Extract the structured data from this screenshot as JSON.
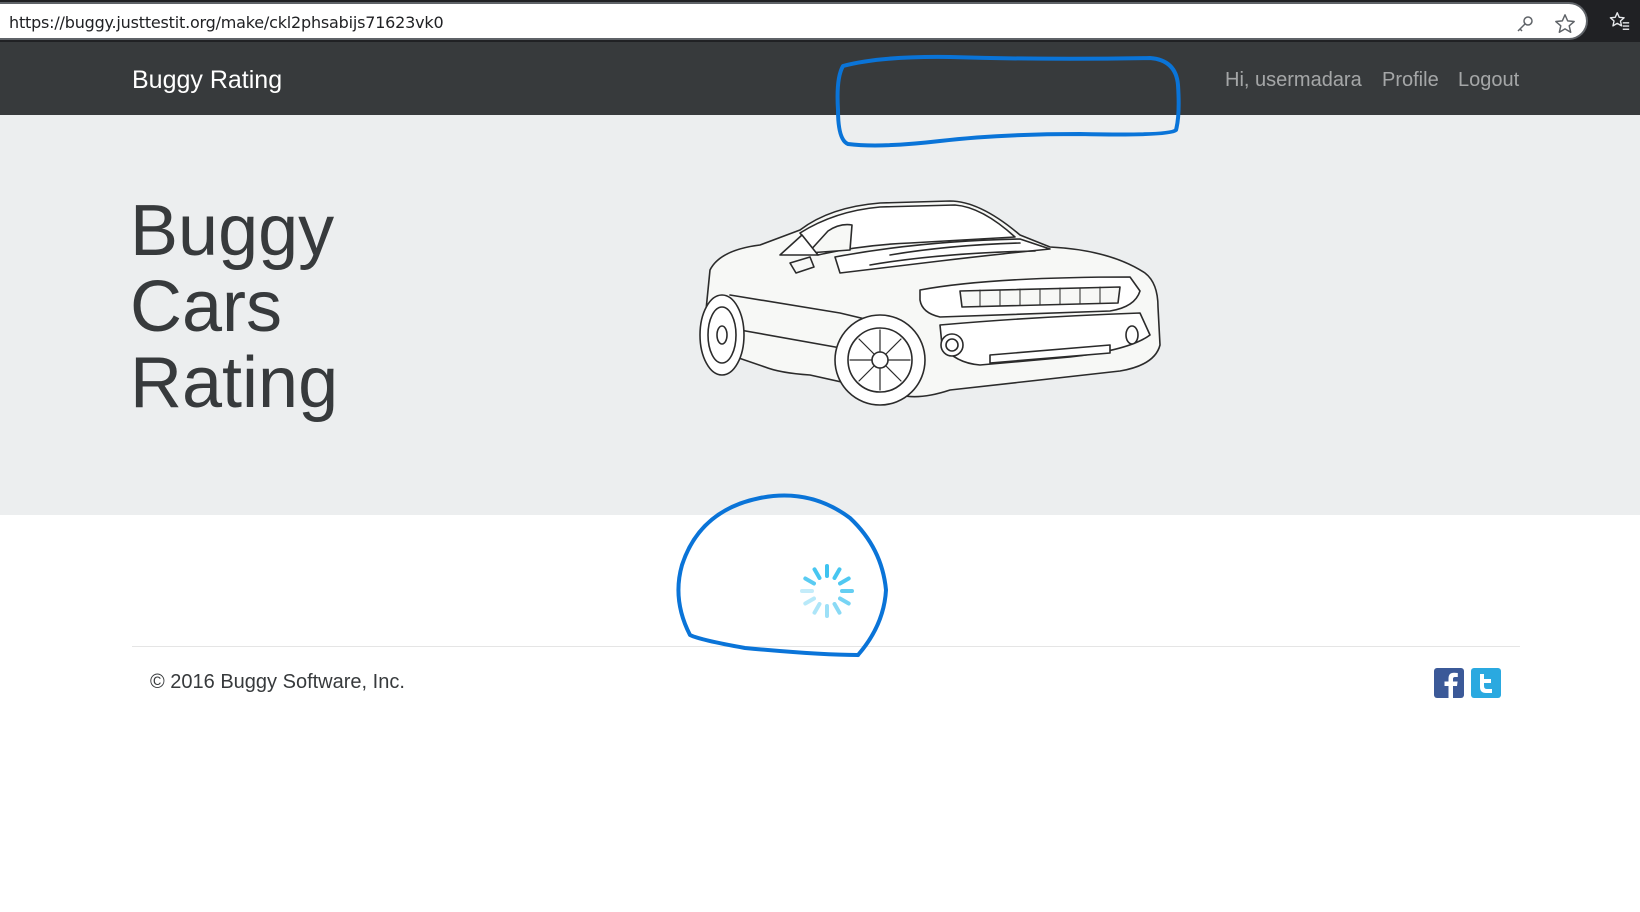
{
  "browser": {
    "url": "https://buggy.justtestit.org/make/ckl2phsabijs71623vk0",
    "icons": [
      "key-icon",
      "star-icon",
      "favorites-icon"
    ]
  },
  "navbar": {
    "brand": "Buggy Rating",
    "greeting": "Hi, usermadara",
    "profile_label": "Profile",
    "logout_label": "Logout"
  },
  "hero": {
    "title_lines": [
      "Buggy",
      "Cars",
      "Rating"
    ],
    "image": "car-sketch"
  },
  "content": {
    "state": "loading",
    "icon": "spinner-icon"
  },
  "footer": {
    "copyright": "© 2016 Buggy Software, Inc.",
    "social_icons": [
      "facebook-icon",
      "twitter-icon"
    ]
  },
  "colors": {
    "navbar_bg": "#373a3c",
    "jumbotron_bg": "#eceeef",
    "spinner": "#3ec3f0",
    "annotation": "#0a74d8",
    "facebook": "#3b5998",
    "twitter": "#2aa9e0"
  }
}
